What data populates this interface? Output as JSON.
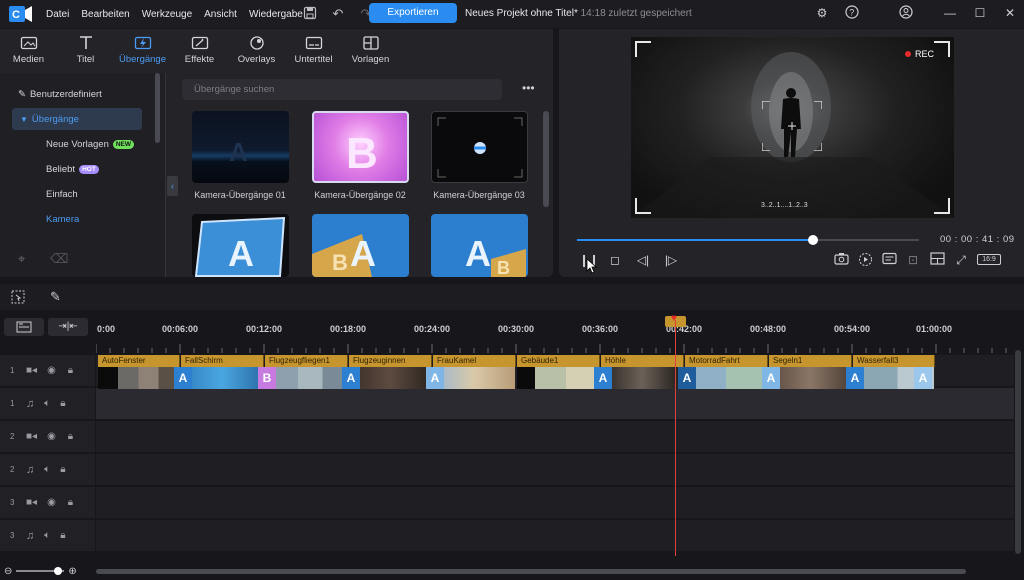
{
  "menu": [
    "Datei",
    "Bearbeiten",
    "Werkzeuge",
    "Ansicht",
    "Wiedergabe"
  ],
  "toolbar": {
    "export_label": "Exportieren"
  },
  "project": {
    "title": "Neues Projekt ohne Titel*",
    "saved": "14:18 zuletzt gespeichert"
  },
  "tabs": [
    {
      "label": "Medien",
      "icon": "media-icon"
    },
    {
      "label": "Titel",
      "icon": "title-icon"
    },
    {
      "label": "Übergänge",
      "icon": "transitions-icon",
      "active": true
    },
    {
      "label": "Effekte",
      "icon": "effects-icon"
    },
    {
      "label": "Overlays",
      "icon": "overlays-icon"
    },
    {
      "label": "Untertitel",
      "icon": "subtitles-icon"
    },
    {
      "label": "Vorlagen",
      "icon": "templates-icon"
    }
  ],
  "sidebar": {
    "custom": "Benutzerdefiniert",
    "section": "Übergänge",
    "items": [
      {
        "label": "Neue Vorlagen",
        "badge": "NEW"
      },
      {
        "label": "Beliebt",
        "badge": "HOT"
      },
      {
        "label": "Einfach"
      },
      {
        "label": "Kamera",
        "active": true
      }
    ]
  },
  "search": {
    "placeholder": "Übergänge suchen"
  },
  "thumbs": [
    {
      "label": "Kamera-Übergänge 01"
    },
    {
      "label": "Kamera-Übergänge 02"
    },
    {
      "label": "Kamera-Übergänge 03"
    }
  ],
  "preview": {
    "rec": "REC",
    "timecode": "00 : 00 : 41 : 09",
    "progress": 0.69,
    "aspect": "16:9",
    "levels": "3..2..1....1..2..3"
  },
  "ruler": [
    "0:00",
    "00:06:00",
    "00:12:00",
    "00:18:00",
    "00:24:00",
    "00:30:00",
    "00:36:00",
    "00:42:00",
    "00:48:00",
    "00:54:00",
    "01:00:00"
  ],
  "tracks": [
    {
      "num": "1",
      "type": "video"
    },
    {
      "num": "1",
      "type": "audio"
    },
    {
      "num": "2",
      "type": "video"
    },
    {
      "num": "2",
      "type": "audio"
    },
    {
      "num": "3",
      "type": "video"
    },
    {
      "num": "3",
      "type": "audio"
    }
  ],
  "clips": [
    "AutoFenster",
    "FallSchirm",
    "Flugzeugfliegen1",
    "Flugzeuginnen",
    "FrauKamel",
    "Gebäude1",
    "Höhle",
    "MotorradFahrt",
    "Segeln1",
    "Wasserfall3"
  ],
  "transition_letters": [
    "A",
    "B",
    "A",
    "A",
    "A",
    "A",
    "A",
    "A",
    "A",
    "A",
    "A"
  ],
  "colors": {
    "accent": "#2a8cf0",
    "clip": "#c7952d",
    "playhead": "#e0403a"
  }
}
